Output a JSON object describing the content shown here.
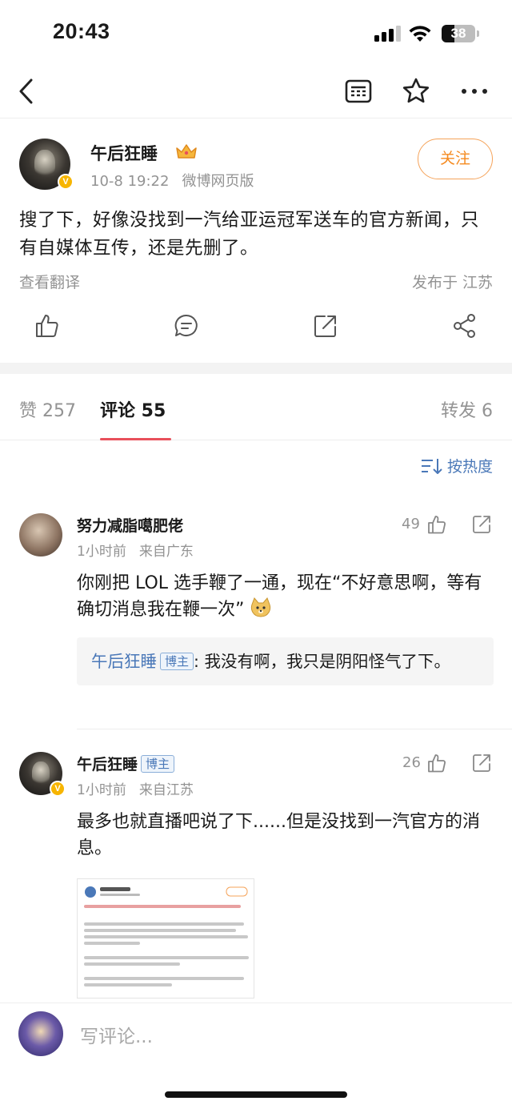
{
  "status_bar": {
    "time": "20:43",
    "battery": "38"
  },
  "nav": {
    "back_icon": "chevron-left-icon",
    "reader_icon": "reader-icon",
    "star_icon": "star-icon",
    "more_icon": "more-icon"
  },
  "post": {
    "author": "午后狂睡",
    "time": "10-8 19:22",
    "source": "微博网页版",
    "follow_label": "关注",
    "text": "搜了下，好像没找到一汽给亚运冠军送车的官方新闻，只有自媒体互传，还是先删了。",
    "translate_label": "查看翻译",
    "location": "发布于 江苏"
  },
  "tabs": {
    "likes": "赞 257",
    "comments": "评论 55",
    "reposts": "转发 6"
  },
  "sort_label": "按热度",
  "comments": [
    {
      "name": "努力减脂噶肥佬",
      "time": "1小时前",
      "from": "来自广东",
      "likes": "49",
      "text": "你刚把 LOL 选手鞭了一通，现在“不好意思啊，等有确切消息我在鞭一次”",
      "reply": {
        "author": "午后狂睡",
        "tag": "博主",
        "text": ": 我没有啊，我只是阴阳怪气了下。"
      }
    },
    {
      "name": "午后狂睡",
      "tag": "博主",
      "time": "1小时前",
      "from": "来自江苏",
      "likes": "26",
      "text": "最多也就直播吧说了下......但是没找到一汽官方的消息。"
    }
  ],
  "bottom": {
    "placeholder": "写评论..."
  }
}
